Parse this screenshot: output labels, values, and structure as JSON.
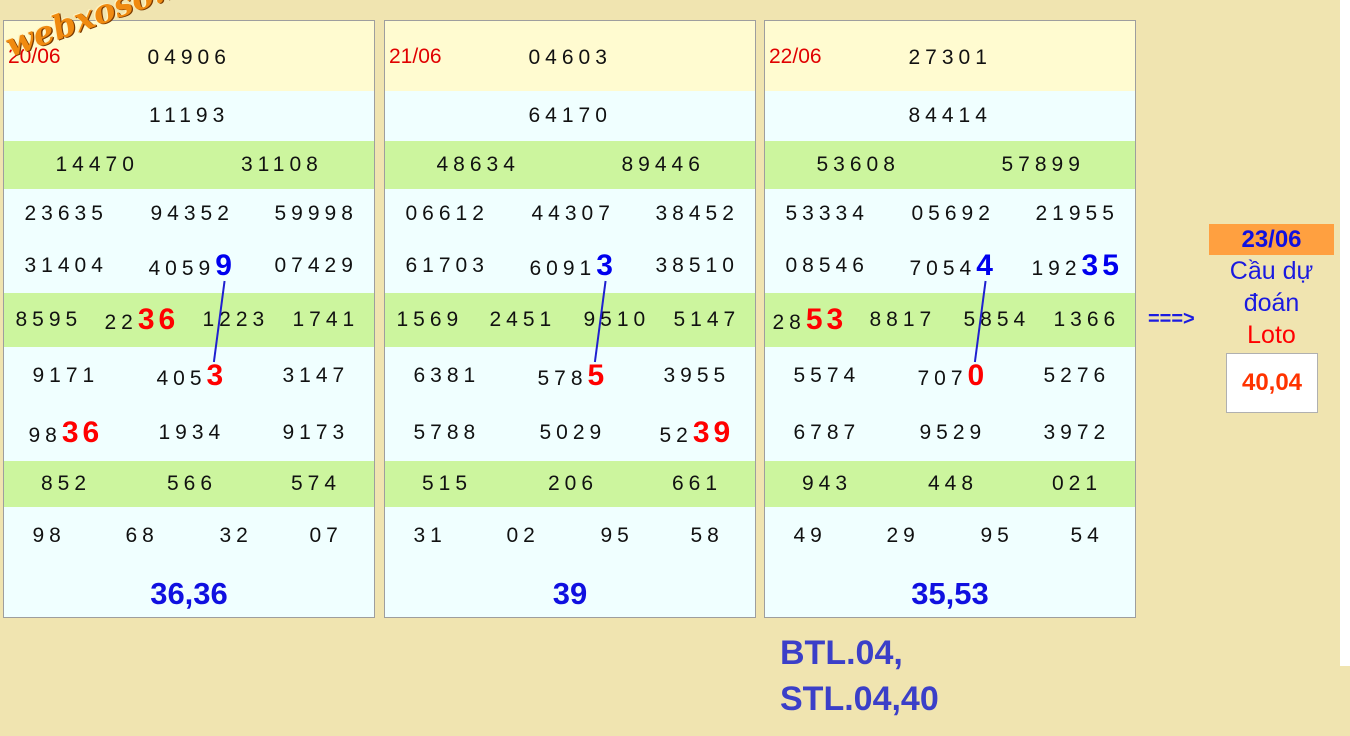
{
  "watermark": "webxoso.net",
  "columns": [
    {
      "date": "20/06",
      "special": "04906",
      "first": "11193",
      "second": [
        "14470",
        "31108"
      ],
      "third_a": [
        "23635",
        "94352",
        "59998"
      ],
      "third_b": [
        {
          "base": "31404",
          "hl": ""
        },
        {
          "base": "4059",
          "hl": "9"
        },
        {
          "base": "07429",
          "hl": ""
        }
      ],
      "fourth": [
        {
          "base": "8595",
          "hl": ""
        },
        {
          "base": "22",
          "hl": "36"
        },
        {
          "base": "1223",
          "hl": ""
        },
        {
          "base": "1741",
          "hl": ""
        }
      ],
      "fifth_a": [
        {
          "base": "9171",
          "hl": ""
        },
        {
          "base": "405",
          "hl": "3"
        },
        {
          "base": "3147",
          "hl": ""
        }
      ],
      "fifth_b": [
        {
          "base": "98",
          "hl": "36"
        },
        {
          "base": "1934",
          "hl": ""
        },
        {
          "base": "9173",
          "hl": ""
        }
      ],
      "sixth": [
        "852",
        "566",
        "574"
      ],
      "seventh": [
        "98",
        "68",
        "32",
        "07"
      ],
      "total": "36,36"
    },
    {
      "date": "21/06",
      "special": "04603",
      "first": "64170",
      "second": [
        "48634",
        "89446"
      ],
      "third_a": [
        "06612",
        "44307",
        "38452"
      ],
      "third_b": [
        {
          "base": "61703",
          "hl": ""
        },
        {
          "base": "6091",
          "hl": "3"
        },
        {
          "base": "38510",
          "hl": ""
        }
      ],
      "fourth": [
        {
          "base": "1569",
          "hl": ""
        },
        {
          "base": "2451",
          "hl": ""
        },
        {
          "base": "9510",
          "hl": ""
        },
        {
          "base": "5147",
          "hl": ""
        }
      ],
      "fifth_a": [
        {
          "base": "6381",
          "hl": ""
        },
        {
          "base": "578",
          "hl": "5"
        },
        {
          "base": "3955",
          "hl": ""
        }
      ],
      "fifth_b": [
        {
          "base": "5788",
          "hl": ""
        },
        {
          "base": "5029",
          "hl": ""
        },
        {
          "base": "52",
          "hl": "39"
        }
      ],
      "sixth": [
        "515",
        "206",
        "661"
      ],
      "seventh": [
        "31",
        "02",
        "95",
        "58"
      ],
      "total": "39"
    },
    {
      "date": "22/06",
      "special": "27301",
      "first": "84414",
      "second": [
        "53608",
        "57899"
      ],
      "third_a": [
        "53334",
        "05692",
        "21955"
      ],
      "third_b": [
        {
          "base": "08546",
          "hl": ""
        },
        {
          "base": "7054",
          "hl": "4"
        },
        {
          "base": "192",
          "hl": "35"
        }
      ],
      "fourth": [
        {
          "base": "28",
          "hl": "53"
        },
        {
          "base": "8817",
          "hl": ""
        },
        {
          "base": "5854",
          "hl": ""
        },
        {
          "base": "1366",
          "hl": ""
        }
      ],
      "fifth_a": [
        {
          "base": "5574",
          "hl": ""
        },
        {
          "base": "707",
          "hl": "0"
        },
        {
          "base": "5276",
          "hl": ""
        }
      ],
      "fifth_b": [
        {
          "base": "6787",
          "hl": ""
        },
        {
          "base": "9529",
          "hl": ""
        },
        {
          "base": "3972",
          "hl": ""
        }
      ],
      "sixth": [
        "943",
        "448",
        "021"
      ],
      "seventh": [
        "49",
        "29",
        "95",
        "54"
      ],
      "total": "35,53"
    }
  ],
  "prediction": {
    "arrow": "===>",
    "date": "23/06",
    "line1": "Cầu dự",
    "line2": "đoán",
    "line3": "Loto",
    "value": "40,04"
  },
  "summary": {
    "line1": "BTL.04,",
    "line2": "STL.04,40"
  },
  "colors": {
    "background": "#f0e4b0",
    "highlight_red": "#ff0000",
    "highlight_blue": "#0000ee",
    "row_green": "#ccf59e",
    "row_cream": "#fffbd0",
    "row_light": "#f0ffff",
    "prediction_date_bg": "#ffa040"
  }
}
